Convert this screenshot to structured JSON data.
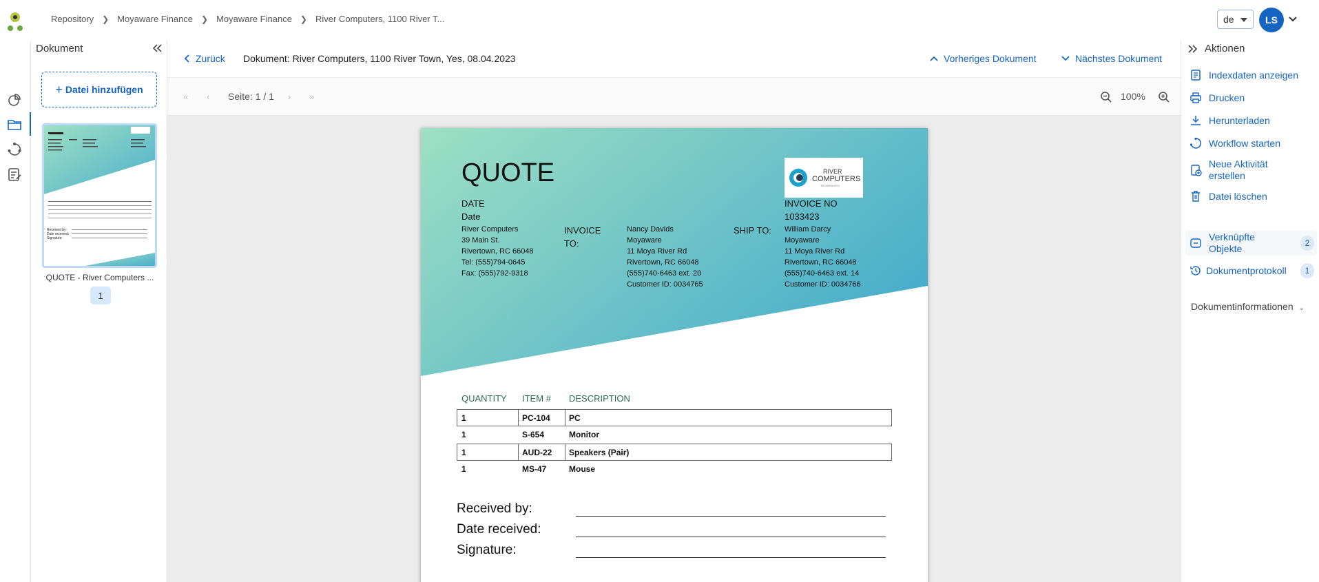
{
  "breadcrumb": {
    "items": [
      "Repository",
      "Moyaware Finance",
      "Moyaware Finance",
      "River Computers, 1100 River T..."
    ]
  },
  "header": {
    "language": "de",
    "avatar_initials": "LS"
  },
  "doc_panel": {
    "title": "Dokument",
    "add_file_label": "Datei hinzufügen",
    "thumbnail_label": "QUOTE - River Computers ...",
    "page_number": "1"
  },
  "doc_header": {
    "back_label": "Zurück",
    "title": "Dokument: River Computers, 1100 River Town, Yes, 08.04.2023",
    "prev_label": "Vorheriges Dokument",
    "next_label": "Nächstes Dokument"
  },
  "toolbar": {
    "page_info": "Seite: 1 / 1",
    "zoom": "100%"
  },
  "document": {
    "heading": "QUOTE",
    "date_label": "DATE",
    "date_value": "Date",
    "from_lines": [
      "River Computers",
      "39 Main St.",
      "Rivertown, RC 66048",
      "Tel: (555)794-0645",
      "Fax: (555)792-9318"
    ],
    "invoice_to_label_1": "INVOICE",
    "invoice_to_label_2": "TO:",
    "invoice_to_lines": [
      "Nancy Davids",
      "Moyaware",
      "11 Moya River Rd",
      "Rivertown, RC 66048",
      "(555)740-6463 ext. 20",
      "Customer ID: 0034765"
    ],
    "ship_to_label": "SHIP TO:",
    "ship_to_lines": [
      "William Darcy",
      "Moyaware",
      "11 Moya River Rd",
      "Rivertown, RC 66048",
      "(555)740-6463 ext. 14",
      "Customer ID: 0034766"
    ],
    "invoice_no_label": "INVOICE NO",
    "invoice_no": "1033423",
    "logo_line1": "RIVER",
    "logo_line2": "COMPUTERS",
    "logo_line3": "TECHNOLOGY",
    "table_headers": [
      "QUANTITY",
      "ITEM #",
      "DESCRIPTION"
    ],
    "rows": [
      [
        "1",
        "PC-104",
        "PC"
      ],
      [
        "1",
        "S-654",
        "Monitor"
      ],
      [
        "1",
        "AUD-22",
        "Speakers (Pair)"
      ],
      [
        "1",
        "MS-47",
        "Mouse"
      ]
    ],
    "received_by": "Received by:",
    "date_received": "Date received:",
    "signature": "Signature:",
    "thumb_received_by": "Received by:",
    "thumb_date_received": "Date received:",
    "thumb_signature": "Signature:"
  },
  "actions": {
    "title": "Aktionen",
    "items": [
      "Indexdaten anzeigen",
      "Drucken",
      "Herunterladen",
      "Workflow starten",
      "Neue Aktivität erstellen",
      "Datei löschen"
    ],
    "linked_objects": "Verknüpfte Objekte",
    "linked_count": "2",
    "doc_protocol": "Dokumentprotokoll",
    "protocol_count": "1",
    "doc_info": "Dokumentinformationen"
  },
  "colors": {
    "accent": "#1565c0",
    "gradient_start": "#9ee0c3",
    "gradient_end": "#4aaecb"
  }
}
